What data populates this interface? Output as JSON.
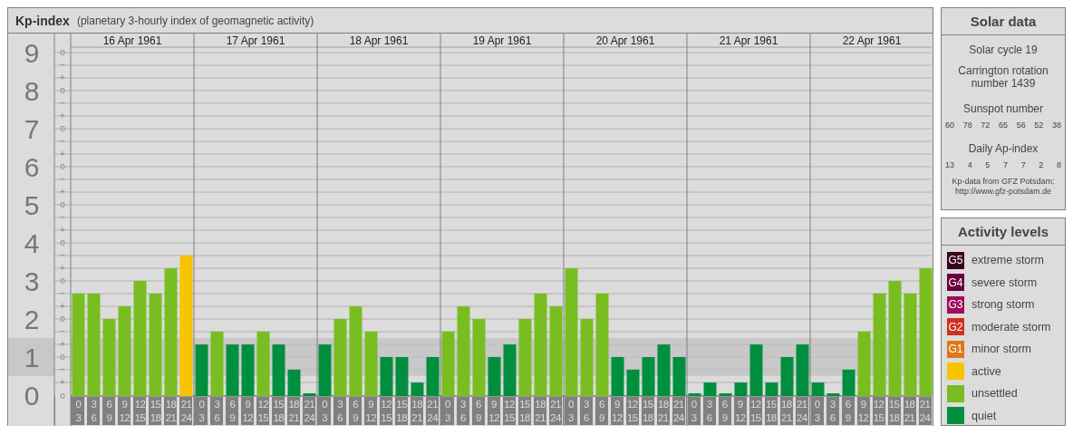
{
  "kp_panel": {
    "title": "Kp-index",
    "subtitle": "(planetary 3-hourly index of geomagnetic activity)",
    "sub_ticks": [
      "o",
      "−",
      "+",
      "o",
      "−",
      "+",
      "o",
      "−",
      "+",
      "o",
      "−",
      "+",
      "o",
      "−",
      "+",
      "o",
      "−",
      "+",
      "o",
      "−",
      "+",
      "o",
      "−",
      "+",
      "o",
      "−",
      "+",
      "o"
    ],
    "days": [
      {
        "date": "16 Apr 1961"
      },
      {
        "date": "17 Apr 1961"
      },
      {
        "date": "18 Apr 1961"
      },
      {
        "date": "19 Apr 1961"
      },
      {
        "date": "20 Apr 1961"
      },
      {
        "date": "21 Apr 1961"
      },
      {
        "date": "22 Apr 1961"
      }
    ],
    "chart_data": {
      "type": "bar",
      "grid": true,
      "categories": [
        "0 3",
        "3 6",
        "6 9",
        "9 12",
        "12 15",
        "15 18",
        "18 21",
        "21 24",
        "0 3",
        "3 6",
        "6 9",
        "9 12",
        "12 15",
        "15 18",
        "18 21",
        "21 24",
        "0 3",
        "3 6",
        "6 9",
        "9 12",
        "12 15",
        "15 18",
        "18 21",
        "21 24",
        "0 3",
        "3 6",
        "6 9",
        "9 12",
        "12 15",
        "15 18",
        "18 21",
        "21 24",
        "0 3",
        "3 6",
        "6 9",
        "9 12",
        "12 15",
        "15 18",
        "18 21",
        "21 24",
        "0 3",
        "3 6",
        "6 9",
        "9 12",
        "12 15",
        "15 18",
        "18 21",
        "21 24",
        "0 3",
        "3 6",
        "6 9",
        "9 12",
        "12 15",
        "15 18",
        "18 21",
        "21 24"
      ],
      "ylim": [
        0,
        9.14
      ],
      "yticks": [
        {
          "value": 0,
          "label": "0"
        },
        {
          "value": 1,
          "label": "1"
        },
        {
          "value": 2,
          "label": "2"
        },
        {
          "value": 3,
          "label": "3"
        },
        {
          "value": 4,
          "label": "4"
        },
        {
          "value": 5,
          "label": "5"
        },
        {
          "value": 6,
          "label": "6"
        },
        {
          "value": 7,
          "label": "7"
        },
        {
          "value": 8,
          "label": "8"
        },
        {
          "value": 9,
          "label": "9"
        }
      ],
      "series": [
        {
          "name": "active",
          "color": "#f8c400",
          "values": [
            null,
            null,
            null,
            null,
            null,
            null,
            null,
            3.67,
            null,
            null,
            null,
            null,
            null,
            null,
            null,
            null,
            null,
            null,
            null,
            null,
            null,
            null,
            null,
            null,
            null,
            null,
            null,
            null,
            null,
            null,
            null,
            null,
            null,
            null,
            null,
            null,
            null,
            null,
            null,
            null,
            null,
            null,
            null,
            null,
            null,
            null,
            null,
            null,
            null,
            null,
            null,
            null,
            null,
            null,
            null,
            null
          ]
        },
        {
          "name": "unsettled",
          "color": "#78be20",
          "values": [
            2.67,
            2.67,
            2,
            2.33,
            3,
            2.67,
            3.33,
            null,
            null,
            1.67,
            null,
            null,
            1.67,
            null,
            null,
            null,
            null,
            2,
            2.33,
            1.67,
            null,
            null,
            null,
            null,
            1.67,
            2.33,
            2,
            null,
            null,
            2,
            2.67,
            2.33,
            3.33,
            2,
            2.67,
            null,
            null,
            null,
            null,
            null,
            null,
            null,
            null,
            null,
            null,
            null,
            null,
            null,
            null,
            null,
            null,
            1.67,
            2.67,
            3,
            2.67,
            3.33
          ]
        },
        {
          "name": "quiet",
          "color": "#008f3e",
          "values": [
            null,
            null,
            null,
            null,
            null,
            null,
            null,
            null,
            1.33,
            null,
            1.33,
            1.33,
            null,
            1.33,
            0.67,
            0,
            1.33,
            null,
            null,
            null,
            1,
            1,
            0.33,
            1,
            null,
            null,
            null,
            1,
            1.33,
            null,
            null,
            null,
            null,
            null,
            null,
            1,
            0.67,
            1,
            1.33,
            1,
            0,
            0.33,
            0,
            0.33,
            1.33,
            0.33,
            1,
            1.33,
            0.33,
            0,
            0.67,
            null,
            null,
            null,
            null,
            null
          ]
        }
      ]
    }
  },
  "solar_data": {
    "title": "Solar data",
    "solar_cycle": "Solar cycle 19",
    "carrington": "Carrington rotation number 1439",
    "sunspot_heading": "Sunspot number",
    "sunspot_numbers": [
      "60",
      "78",
      "72",
      "65",
      "56",
      "52",
      "38"
    ],
    "ap_heading": "Daily Ap-index",
    "ap_values": [
      "13",
      "4",
      "5",
      "7",
      "7",
      "2",
      "8"
    ],
    "credit_lines": [
      "Kp-data from GFZ Potsdam:",
      "http://www.gfz-potsdam.de"
    ]
  },
  "activity_levels": {
    "title": "Activity levels",
    "storm_levels": [
      {
        "badge": "G5",
        "label": "extreme storm",
        "color": "#3c0020"
      },
      {
        "badge": "G4",
        "label": "severe storm",
        "color": "#6a0040"
      },
      {
        "badge": "G3",
        "label": "strong storm",
        "color": "#a00c5a"
      },
      {
        "badge": "G2",
        "label": "moderate storm",
        "color": "#d03020"
      },
      {
        "badge": "G1",
        "label": "minor storm",
        "color": "#e07818"
      }
    ]
  }
}
